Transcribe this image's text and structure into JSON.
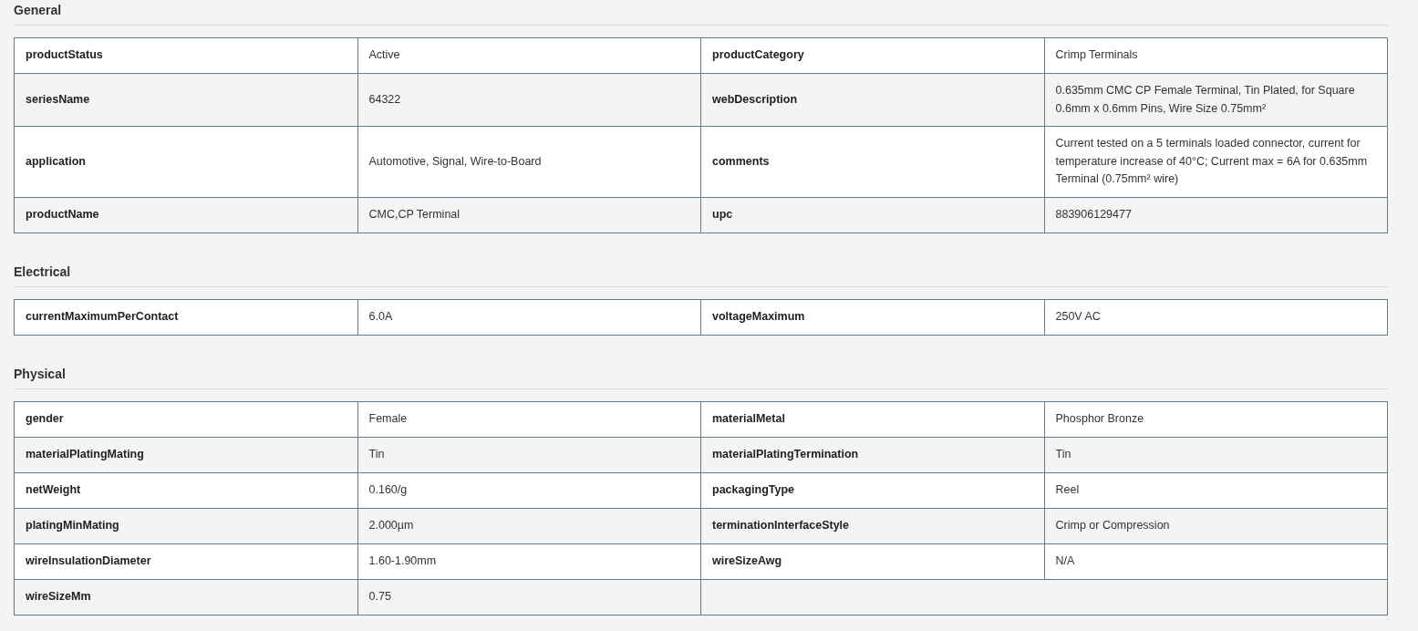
{
  "sections": [
    {
      "title": "General",
      "rows": [
        {
          "pairs": [
            {
              "label": "productStatus",
              "value": "Active"
            },
            {
              "label": "productCategory",
              "value": "Crimp Terminals"
            }
          ]
        },
        {
          "pairs": [
            {
              "label": "seriesName",
              "value": "64322"
            },
            {
              "label": "webDescription",
              "value": "0.635mm CMC CP Female Terminal, Tin Plated, for Square 0.6mm x 0.6mm Pins, Wire Size 0.75mm²"
            }
          ]
        },
        {
          "pairs": [
            {
              "label": "application",
              "value": "Automotive, Signal, Wire-to-Board"
            },
            {
              "label": "comments",
              "value": "Current tested on a 5 terminals loaded connector, current for temperature increase of 40°C; Current max = 6A for 0.635mm Terminal (0.75mm² wire)"
            }
          ]
        },
        {
          "pairs": [
            {
              "label": "productName",
              "value": "CMC,CP Terminal"
            },
            {
              "label": "upc",
              "value": "883906129477"
            }
          ]
        }
      ]
    },
    {
      "title": "Electrical",
      "rows": [
        {
          "pairs": [
            {
              "label": "currentMaximumPerContact",
              "value": "6.0A"
            },
            {
              "label": "voltageMaximum",
              "value": "250V AC"
            }
          ]
        }
      ]
    },
    {
      "title": "Physical",
      "rows": [
        {
          "pairs": [
            {
              "label": "gender",
              "value": "Female"
            },
            {
              "label": "materialMetal",
              "value": "Phosphor Bronze"
            }
          ]
        },
        {
          "pairs": [
            {
              "label": "materialPlatingMating",
              "value": "Tin"
            },
            {
              "label": "materialPlatingTermination",
              "value": "Tin"
            }
          ]
        },
        {
          "pairs": [
            {
              "label": "netWeight",
              "value": "0.160/g"
            },
            {
              "label": "packagingType",
              "value": "Reel"
            }
          ]
        },
        {
          "pairs": [
            {
              "label": "platingMinMating",
              "value": "2.000µm"
            },
            {
              "label": "terminationInterfaceStyle",
              "value": "Crimp or Compression"
            }
          ]
        },
        {
          "pairs": [
            {
              "label": "wireInsulationDiameter",
              "value": "1.60-1.90mm"
            },
            {
              "label": "wireSizeAwg",
              "value": "N/A"
            }
          ]
        },
        {
          "pairs": [
            {
              "label": "wireSizeMm",
              "value": "0.75"
            }
          ]
        }
      ]
    }
  ]
}
